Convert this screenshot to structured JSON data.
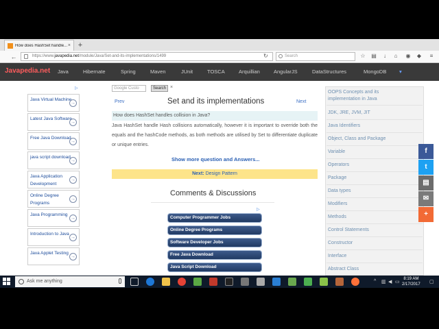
{
  "browser": {
    "tab_title": "How does HashSet handle...",
    "url_prefix": "https://www.",
    "url_domain": "javapedia.net",
    "url_path": "/module/Java/Set-and-its-implementations/1499",
    "search_placeholder": "Search"
  },
  "site": {
    "logo": "Javapedia.net",
    "nav": [
      "Java",
      "Hibernate",
      "Spring",
      "Maven",
      "JUnit",
      "TOSCA",
      "Arquillian",
      "AngularJS",
      "DataStructures",
      "MongoDB"
    ]
  },
  "left_ads": [
    "Java Virtual Machine",
    "Latest Java Software",
    "Free Java Download",
    "java script download",
    "Java Application Development",
    "Online Degree Programs",
    "Java Programming",
    "Introduction to Java",
    "Java Applet Testing"
  ],
  "search": {
    "placeholder": "Custo",
    "google": "Google",
    "button": "Search",
    "clear": "×"
  },
  "content": {
    "prev": "Prev",
    "next": "Next",
    "title": "Set and its implementations",
    "question": "How does HashSet handles collision in Java?",
    "answer": "Java HashSet handle Hash collisions automatically, however it is important to override both the equals and the hashCode methods, as both methods are utilised by Set to differentiate duplicate or unique entries.",
    "more": "Show more question and Answers...",
    "next_label": "Next:",
    "next_link": "Design Pattern",
    "comments_title": "Comments & Discussions"
  },
  "content_ads": [
    "Computer Programmer Jobs",
    "Online Degree Programs",
    "Software Developer Jobs",
    "Free Java Download",
    "Java Script Download"
  ],
  "right_menu": [
    "OOPS Concepts and its implementation in Java",
    "JDK, JRE, JVM, JIT",
    "Java Identifiers",
    "Object, Class and Package",
    "Variable",
    "Operators",
    "Package",
    "Data types",
    "Modifiers",
    "Methods",
    "Control Statements",
    "Constructor",
    "Interface",
    "Abstract Class"
  ],
  "social": [
    {
      "icon": "facebook-icon",
      "glyph": "f",
      "color": "#3b5998"
    },
    {
      "icon": "twitter-icon",
      "glyph": "t",
      "color": "#1da1f2"
    },
    {
      "icon": "print-icon",
      "glyph": "▤",
      "color": "#6c6c6c"
    },
    {
      "icon": "email-icon",
      "glyph": "✉",
      "color": "#7a7a7a"
    },
    {
      "icon": "plus-icon",
      "glyph": "+",
      "color": "#f26a35"
    }
  ],
  "taskbar": {
    "search_placeholder": "Ask me anything",
    "time": "8:19 AM",
    "date": "2/17/2017"
  }
}
